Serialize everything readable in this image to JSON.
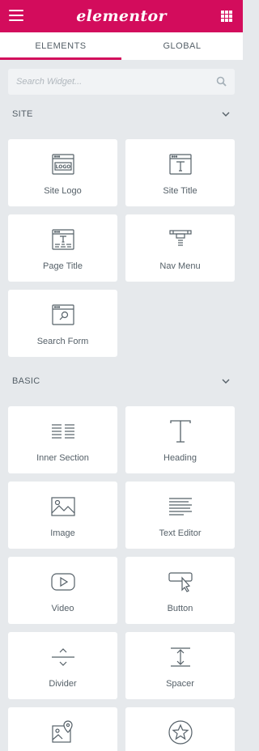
{
  "header": {
    "logo_text": "elementor"
  },
  "tabs": [
    {
      "label": "ELEMENTS",
      "active": true
    },
    {
      "label": "GLOBAL",
      "active": false
    }
  ],
  "search": {
    "placeholder": "Search Widget..."
  },
  "sections": [
    {
      "title": "SITE",
      "widgets": [
        {
          "label": "Site Logo",
          "icon": "site-logo-icon"
        },
        {
          "label": "Site Title",
          "icon": "site-title-icon"
        },
        {
          "label": "Page Title",
          "icon": "page-title-icon"
        },
        {
          "label": "Nav Menu",
          "icon": "nav-menu-icon"
        },
        {
          "label": "Search Form",
          "icon": "search-form-icon"
        }
      ]
    },
    {
      "title": "BASIC",
      "widgets": [
        {
          "label": "Inner Section",
          "icon": "inner-section-icon"
        },
        {
          "label": "Heading",
          "icon": "heading-icon"
        },
        {
          "label": "Image",
          "icon": "image-icon"
        },
        {
          "label": "Text Editor",
          "icon": "text-editor-icon"
        },
        {
          "label": "Video",
          "icon": "video-icon"
        },
        {
          "label": "Button",
          "icon": "button-icon"
        },
        {
          "label": "Divider",
          "icon": "divider-icon"
        },
        {
          "label": "Spacer",
          "icon": "spacer-icon"
        },
        {
          "label": "",
          "icon": "google-maps-icon"
        },
        {
          "label": "",
          "icon": "icon-widget-icon"
        }
      ]
    }
  ],
  "colors": {
    "brand": "#d30c5c",
    "panel_bg": "#e6e9ec",
    "card_bg": "#ffffff",
    "text": "#556068"
  }
}
